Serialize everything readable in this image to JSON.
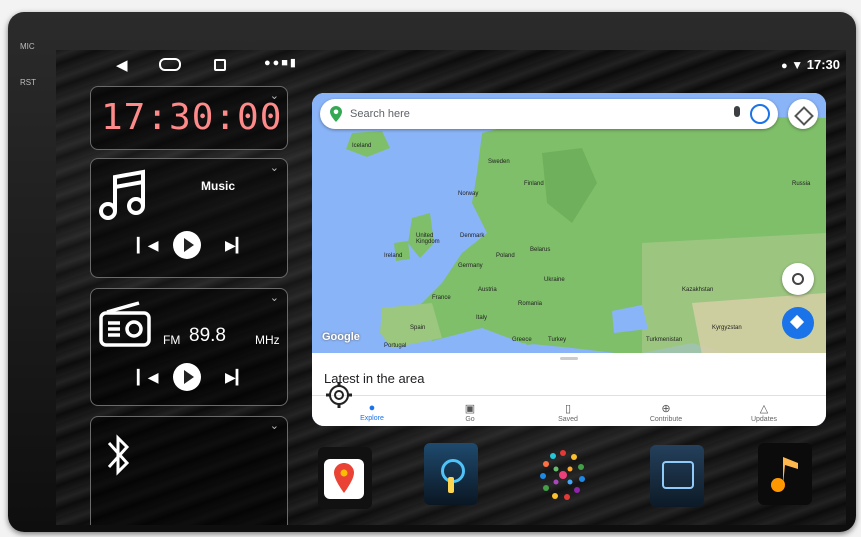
{
  "hardware": {
    "mic_label": "MIC",
    "rst_label": "RST"
  },
  "status_bar": {
    "time": "17:30"
  },
  "widgets": {
    "clock": {
      "time": "17:30:00"
    },
    "music": {
      "title": "Music"
    },
    "radio": {
      "band": "FM",
      "frequency": "89.8",
      "unit": "MHz"
    }
  },
  "map": {
    "search_placeholder": "Search here",
    "google_logo": "Google",
    "latest_title": "Latest in the area",
    "tabs": [
      {
        "label": "Explore",
        "icon": "pin-icon"
      },
      {
        "label": "Go",
        "icon": "car-icon"
      },
      {
        "label": "Saved",
        "icon": "bookmark-icon"
      },
      {
        "label": "Contribute",
        "icon": "plus-circle-icon"
      },
      {
        "label": "Updates",
        "icon": "bell-icon"
      }
    ],
    "countries": [
      "Iceland",
      "Sweden",
      "Finland",
      "Russia",
      "Norway",
      "United Kingdom",
      "Denmark",
      "Ireland",
      "Poland",
      "Belarus",
      "Germany",
      "Ukraine",
      "Kazakhstan",
      "France",
      "Austria",
      "Romania",
      "Spain",
      "Italy",
      "Kyrgyzstan",
      "Portugal",
      "Greece",
      "Turkey",
      "Turkmenistan"
    ]
  },
  "dock": [
    {
      "name": "google-maps-app-icon"
    },
    {
      "name": "podcast-app-icon"
    },
    {
      "name": "dots-launcher-icon"
    },
    {
      "name": "phone-app-icon"
    },
    {
      "name": "music-app-icon"
    }
  ],
  "colors": {
    "accent_blue": "#1a73e8",
    "clock_red": "#ff8a8a",
    "land_green": "#7fbf6a",
    "sea_blue": "#8ab4f8"
  }
}
